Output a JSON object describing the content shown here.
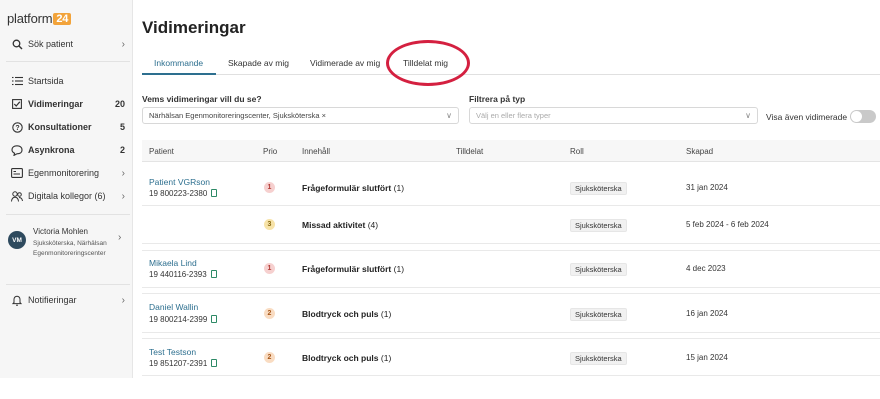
{
  "app": {
    "logo_text": "platform",
    "logo_badge": "24"
  },
  "sidebar": {
    "search": {
      "label": "Sök patient"
    },
    "items": [
      {
        "label": "Startsida",
        "icon": "list-icon"
      },
      {
        "label": "Vidimeringar",
        "count": "20",
        "icon": "checkbox-icon"
      },
      {
        "label": "Konsultationer",
        "count": "5",
        "icon": "question-icon"
      },
      {
        "label": "Asynkrona",
        "count": "2",
        "icon": "chat-icon"
      },
      {
        "label": "Egenmonitorering",
        "icon": "monitor-icon"
      },
      {
        "label": "Digitala kollegor (6)",
        "icon": "people-icon"
      }
    ],
    "user": {
      "initials": "VM",
      "name": "Victoria Mohlen",
      "role": "Sjuksköterska, Närhälsan Egenmonitoreringscenter"
    },
    "notifications": {
      "label": "Notifieringar"
    }
  },
  "main": {
    "title": "Vidimeringar",
    "tabs": [
      {
        "label": "Inkommande",
        "active": true
      },
      {
        "label": "Skapade av mig"
      },
      {
        "label": "Vidimerade av mig"
      },
      {
        "label": "Tilldelat mig"
      }
    ],
    "filter_whose": {
      "label": "Vems vidimeringar vill du se?",
      "value": "Närhälsan Egenmonitoreringscenter, Sjuksköterska",
      "remove": "×"
    },
    "filter_type": {
      "label": "Filtrera på typ",
      "placeholder": "Välj en eller flera typer"
    },
    "toggle": {
      "label": "Visa även vidimerade",
      "on": false
    },
    "table": {
      "headers": [
        "Patient",
        "Prio",
        "Innehåll",
        "Tilldelat",
        "Roll",
        "Skapad"
      ],
      "rows": [
        {
          "name": "Patient VGRson",
          "id": "19 800223-2380",
          "prio": "1",
          "content": "Frågeformulär slutfört",
          "content_count": "(1)",
          "role": "Sjuksköterska",
          "created": "31 jan 2024"
        },
        {
          "name": "",
          "id": "",
          "prio": "3",
          "content": "Missad aktivitet",
          "content_count": "(4)",
          "role": "Sjuksköterska",
          "created": "5 feb 2024 - 6 feb 2024"
        },
        {
          "name": "Mikaela Lind",
          "id": "19 440116-2393",
          "prio": "1",
          "content": "Frågeformulär slutfört",
          "content_count": "(1)",
          "role": "Sjuksköterska",
          "created": "4 dec 2023"
        },
        {
          "name": "Daniel Wallin",
          "id": "19 800214-2399",
          "prio": "2",
          "content": "Blodtryck och puls",
          "content_count": "(1)",
          "role": "Sjuksköterska",
          "created": "16 jan 2024"
        },
        {
          "name": "Test Testson",
          "id": "19 851207-2391",
          "prio": "2",
          "content": "Blodtryck och puls",
          "content_count": "(1)",
          "role": "Sjuksköterska",
          "created": "15 jan 2024"
        }
      ]
    }
  },
  "colors": {
    "accent": "#2d6f8f",
    "logo_badge": "#f2a33a",
    "annotation_circle": "#d42040"
  }
}
